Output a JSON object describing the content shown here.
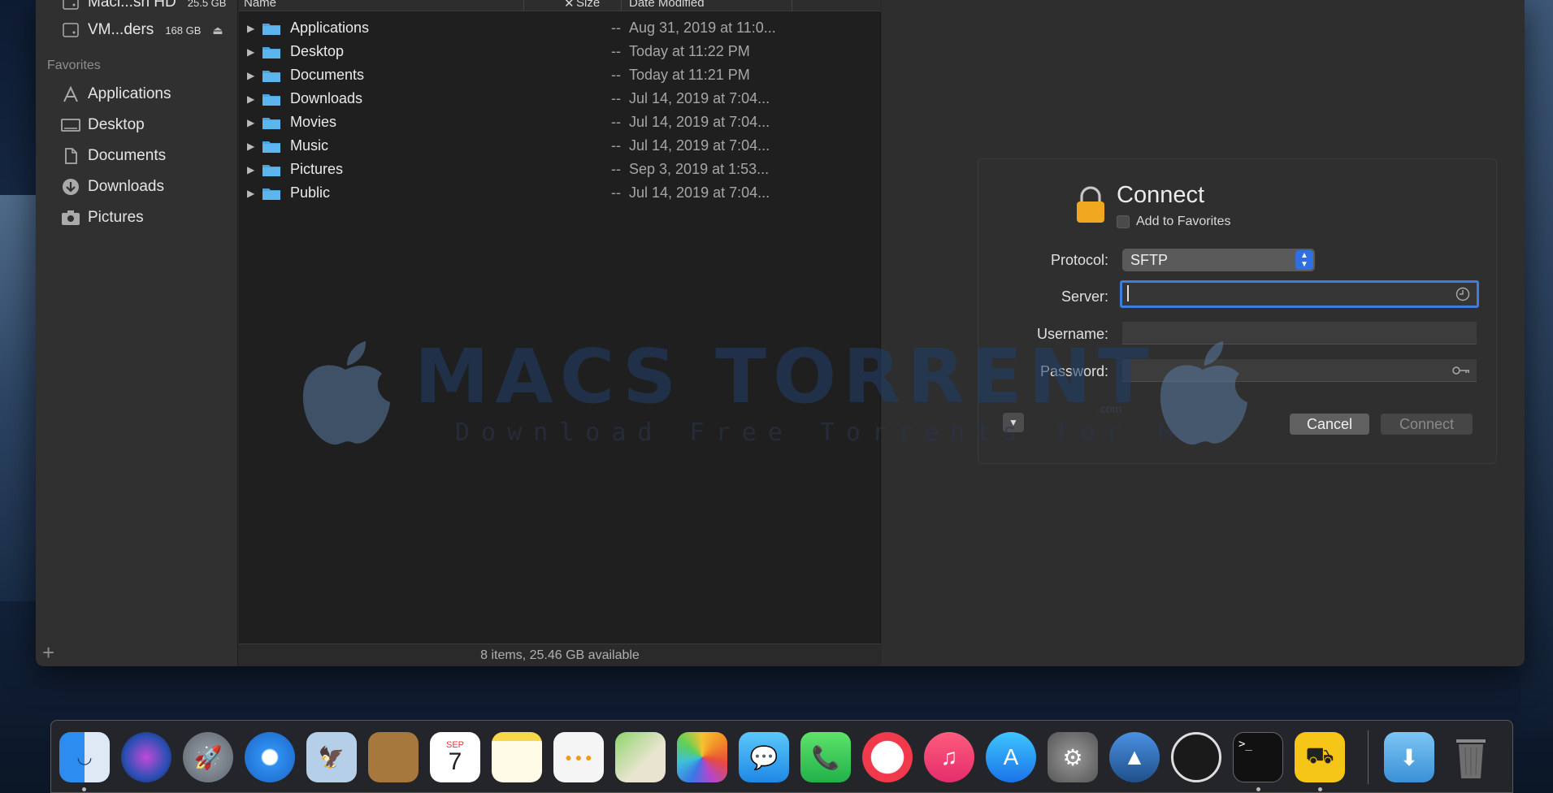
{
  "sidebar": {
    "devices": [
      {
        "name": "Maci...sh HD",
        "badge": "25.5 GB"
      },
      {
        "name": "VM...ders",
        "badge": "168 GB",
        "eject": "⏏"
      }
    ],
    "section": "Favorites",
    "favorites": [
      {
        "label": "Applications",
        "icon": "applications-icon"
      },
      {
        "label": "Desktop",
        "icon": "desktop-icon"
      },
      {
        "label": "Documents",
        "icon": "documents-icon"
      },
      {
        "label": "Downloads",
        "icon": "downloads-icon"
      },
      {
        "label": "Pictures",
        "icon": "pictures-icon"
      }
    ],
    "add": "+"
  },
  "filelist": {
    "columns": {
      "name": "Name",
      "size": "Size",
      "date": "Date Modified"
    },
    "rows": [
      {
        "name": "Applications",
        "size": "--",
        "date": "Aug 31, 2019 at 11:0..."
      },
      {
        "name": "Desktop",
        "size": "--",
        "date": "Today at 11:22 PM"
      },
      {
        "name": "Documents",
        "size": "--",
        "date": "Today at 11:21 PM"
      },
      {
        "name": "Downloads",
        "size": "--",
        "date": "Jul 14, 2019 at 7:04..."
      },
      {
        "name": "Movies",
        "size": "--",
        "date": "Jul 14, 2019 at 7:04..."
      },
      {
        "name": "Music",
        "size": "--",
        "date": "Jul 14, 2019 at 7:04..."
      },
      {
        "name": "Pictures",
        "size": "--",
        "date": "Sep 3, 2019 at 1:53..."
      },
      {
        "name": "Public",
        "size": "--",
        "date": "Jul 14, 2019 at 7:04..."
      }
    ],
    "status": "8 items, 25.46 GB available"
  },
  "connect": {
    "title": "Connect",
    "add_to_favorites": "Add to Favorites",
    "protocol_label": "Protocol:",
    "protocol_value": "SFTP",
    "server_label": "Server:",
    "username_label": "Username:",
    "password_label": "Password:",
    "cancel": "Cancel",
    "connect": "Connect"
  },
  "watermark": {
    "title": "MACS TORRENT",
    "subtitle": "Download Free Torrents for Mac",
    "domain": ".com"
  },
  "dock": {
    "apps": [
      "finder-icon",
      "siri-icon",
      "launchpad-icon",
      "safari-icon",
      "mail-icon",
      "contacts-icon",
      "calendar-icon",
      "notes-icon",
      "reminders-icon",
      "maps-icon",
      "photos-icon",
      "messages-icon",
      "facetime-icon",
      "news-icon",
      "music-icon",
      "app-store-icon",
      "system-preferences-icon",
      "altitude-icon",
      "transmit-icon",
      "terminal-icon",
      "forklift-icon"
    ],
    "calendar_month": "SEP",
    "calendar_day": "7",
    "terminal_prompt": ">_"
  }
}
